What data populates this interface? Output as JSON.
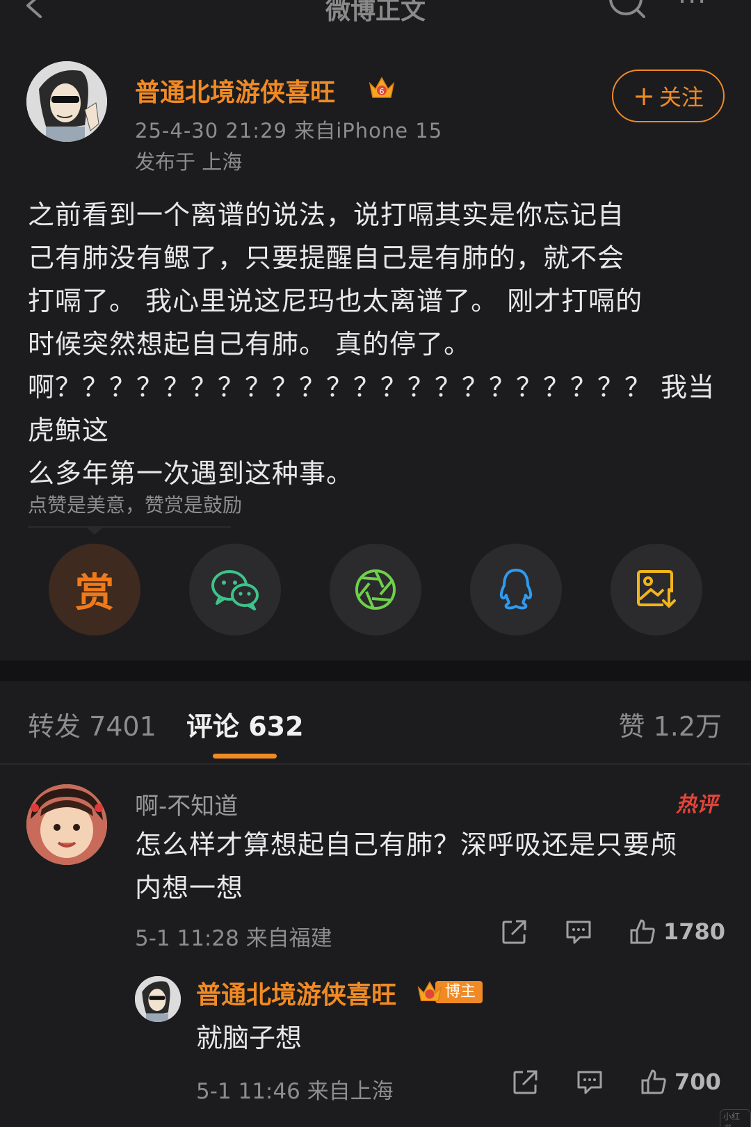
{
  "nav": {
    "title": "微博正文",
    "more": "···"
  },
  "post": {
    "author": "普通北境游侠喜旺",
    "meta": "25-4-30 21:29  来自iPhone 15",
    "location": "发布于 上海",
    "follow_label": "关注",
    "body_lines": [
      "之前看到一个离谱的说法，说打嗝其实是你忘记自",
      "己有肺没有鳃了，只要提醒自己是有肺的，就不会",
      "打嗝了。 我心里说这尼玛也太离谱了。 刚才打嗝的",
      "时候突然想起自己有肺。 真的停了。",
      "啊？？？？？？？？？？？？？？？？？？？？？？  我当虎鲸这",
      "么多年第一次遇到这种事。"
    ],
    "reward_hint": "点赞是美意，赞赏是鼓励",
    "reward_char": "赏"
  },
  "tabs": {
    "repost": "转发 7401",
    "comment": "评论 632",
    "like": "赞 1.2万"
  },
  "comment": {
    "username": "啊-不知道",
    "hot_tag": "热评",
    "text_lines": [
      "怎么样才算想起自己有肺？深呼吸还是只要颅",
      "内想一想"
    ],
    "meta": "5-1 11:28  来自福建",
    "likes": "1780"
  },
  "reply": {
    "username": "普通北境游侠喜旺",
    "badge": "博主",
    "text": "就脑子想",
    "meta": "5-1 11:46  来自上海",
    "likes": "700"
  },
  "watermark": "小红书",
  "colors": {
    "accent": "#f08a24",
    "background": "#1c1c1e",
    "hot": "#e0453a",
    "wechat": "#3cc48a",
    "moments": "#6fd04a",
    "qq": "#2f9bf0",
    "save": "#f2b51a"
  }
}
